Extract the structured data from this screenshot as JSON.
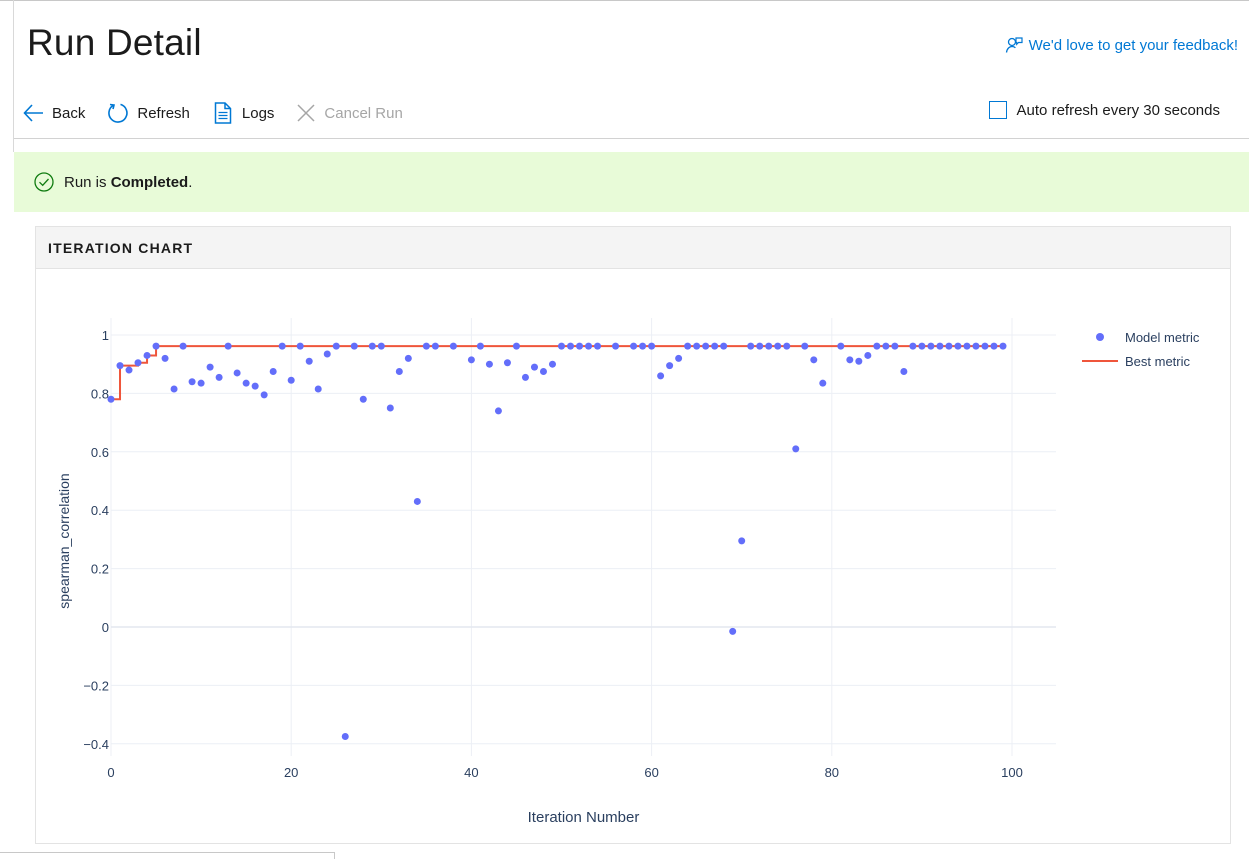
{
  "page": {
    "title": "Run Detail",
    "feedback_link": "We'd love to get your feedback!"
  },
  "toolbar": {
    "back_label": "Back",
    "refresh_label": "Refresh",
    "logs_label": "Logs",
    "cancel_label": "Cancel Run",
    "auto_refresh_label": "Auto refresh every 30 seconds",
    "auto_refresh_checked": false
  },
  "status": {
    "prefix": "Run is ",
    "state": "Completed",
    "suffix": ".",
    "color": "#e8fbd8",
    "icon": "check-circle-icon"
  },
  "section": {
    "title": "ITERATION CHART"
  },
  "colors": {
    "accent": "#0078d4",
    "model_metric": "#636efa",
    "best_metric": "#ef553b"
  },
  "chart_data": {
    "type": "scatter",
    "xlabel": "Iteration Number",
    "ylabel": "spearman_correlation",
    "xlim": [
      0,
      105
    ],
    "ylim": [
      -0.45,
      1.06
    ],
    "x_ticks": [
      0,
      20,
      40,
      60,
      80,
      100
    ],
    "y_ticks": [
      1,
      0.8,
      0.6,
      0.4,
      0.2,
      0,
      -0.2,
      -0.4
    ],
    "y_tick_labels": [
      "1",
      "0.8",
      "0.6",
      "0.4",
      "0.2",
      "0",
      "−0.2",
      "−0.4"
    ],
    "grid": true,
    "legend_position": "top-right",
    "series": [
      {
        "name": "Model metric",
        "mode": "markers",
        "x": [
          0,
          1,
          2,
          3,
          4,
          5,
          6,
          7,
          8,
          9,
          10,
          11,
          12,
          13,
          14,
          15,
          16,
          17,
          18,
          19,
          20,
          21,
          22,
          23,
          24,
          25,
          26,
          27,
          28,
          29,
          30,
          31,
          32,
          33,
          34,
          35,
          36,
          38,
          40,
          41,
          42,
          43,
          44,
          45,
          46,
          47,
          48,
          49,
          50,
          51,
          52,
          53,
          54,
          56,
          58,
          59,
          60,
          61,
          62,
          63,
          64,
          65,
          66,
          67,
          68,
          69,
          70,
          71,
          72,
          73,
          74,
          75,
          76,
          77,
          78,
          79,
          81,
          82,
          83,
          84,
          85,
          86,
          87,
          88,
          89,
          90,
          91,
          92,
          93,
          94,
          95,
          96,
          97,
          98,
          99
        ],
        "y": [
          0.78,
          0.895,
          0.88,
          0.905,
          0.93,
          0.962,
          0.92,
          0.815,
          0.962,
          0.84,
          0.835,
          0.89,
          0.855,
          0.962,
          0.87,
          0.835,
          0.825,
          0.795,
          0.875,
          0.962,
          0.845,
          0.962,
          0.91,
          0.815,
          0.935,
          0.962,
          -0.375,
          0.962,
          0.78,
          0.962,
          0.962,
          0.75,
          0.875,
          0.92,
          0.43,
          0.962,
          0.962,
          0.962,
          0.915,
          0.962,
          0.9,
          0.74,
          0.905,
          0.962,
          0.855,
          0.89,
          0.875,
          0.9,
          0.962,
          0.962,
          0.962,
          0.962,
          0.962,
          0.962,
          0.962,
          0.962,
          0.962,
          0.86,
          0.895,
          0.92,
          0.962,
          0.962,
          0.962,
          0.962,
          0.962,
          -0.015,
          0.295,
          0.962,
          0.962,
          0.962,
          0.962,
          0.962,
          0.61,
          0.962,
          0.915,
          0.835,
          0.962,
          0.915,
          0.91,
          0.93,
          0.962,
          0.962,
          0.962,
          0.875,
          0.962,
          0.962,
          0.962,
          0.962,
          0.962,
          0.962,
          0.962,
          0.962,
          0.962,
          0.962,
          0.962
        ]
      },
      {
        "name": "Best metric",
        "mode": "line",
        "x": [
          0,
          1,
          2,
          3,
          4,
          5,
          99
        ],
        "y": [
          0.78,
          0.895,
          0.895,
          0.905,
          0.93,
          0.962,
          0.962
        ]
      }
    ]
  }
}
